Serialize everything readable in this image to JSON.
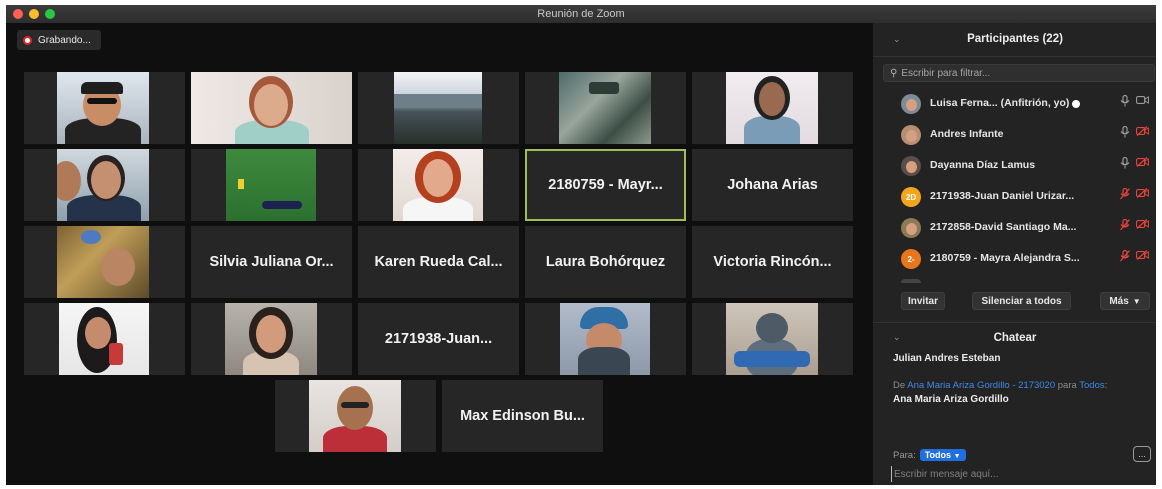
{
  "window": {
    "title": "Reunión de Zoom"
  },
  "recording": {
    "label": "Grabando..."
  },
  "gallery": {
    "tiles": [
      {
        "name": ""
      },
      {
        "name": ""
      },
      {
        "name": ""
      },
      {
        "name": ""
      },
      {
        "name": ""
      },
      {
        "name": ""
      },
      {
        "name": ""
      },
      {
        "name": ""
      },
      {
        "name": "2180759 - Mayr..."
      },
      {
        "name": "Johana Arias"
      },
      {
        "name": ""
      },
      {
        "name": "Silvia Juliana Or..."
      },
      {
        "name": "Karen Rueda Cal..."
      },
      {
        "name": "Laura Bohórquez"
      },
      {
        "name": "Victoria Rincón..."
      },
      {
        "name": ""
      },
      {
        "name": ""
      },
      {
        "name": "2171938-Juan..."
      },
      {
        "name": ""
      },
      {
        "name": ""
      },
      {
        "name": ""
      },
      {
        "name": "Max Edinson Bu..."
      }
    ]
  },
  "participants": {
    "title": "Participantes (22)",
    "filter_placeholder": "Escribir para filtrar...",
    "items": [
      {
        "name": "Luisa Ferna...  (Anfitrión, yo)",
        "avatar": "photo",
        "mic": "on",
        "video": "on"
      },
      {
        "name": "Andres Infante",
        "avatar": "photo",
        "mic": "on",
        "video": "off"
      },
      {
        "name": "Dayanna Díaz Lamus",
        "avatar": "photo",
        "mic": "on",
        "video": "off"
      },
      {
        "name": "2171938-Juan Daniel Urizar...",
        "avatar": "2D",
        "avatar_color": "#f2a51e",
        "mic": "off",
        "video": "off"
      },
      {
        "name": "2172858-David Santiago Ma...",
        "avatar": "photo",
        "mic": "off",
        "video": "off"
      },
      {
        "name": "2180759 - Mayra Alejandra S...",
        "avatar": "2-",
        "avatar_color": "#e8761c",
        "mic": "off",
        "video": "off"
      }
    ],
    "invite_label": "Invitar",
    "mute_all_label": "Silenciar a todos",
    "more_label": "Más"
  },
  "chat": {
    "title": "Chatear",
    "messages": [
      {
        "sender": "Julian Andres Esteban"
      }
    ],
    "meta": {
      "from_prefix": "De ",
      "from_name": "Ana Maria Ariza Gordillo - 2173020",
      "to_prefix": " para ",
      "to_name": "Todos",
      "suffix": ":"
    },
    "last_message": "Ana Maria Ariza Gordillo",
    "to_label": "Para:",
    "to_value": "Todos",
    "more_icon": "...",
    "input_placeholder": "Escribir mensaje aquí..."
  },
  "icons": {
    "mic_on": "mic-icon",
    "mic_off": "mic-muted-icon",
    "cam_on": "camera-icon",
    "cam_off": "camera-off-icon",
    "muted_color": "#e8443a"
  }
}
